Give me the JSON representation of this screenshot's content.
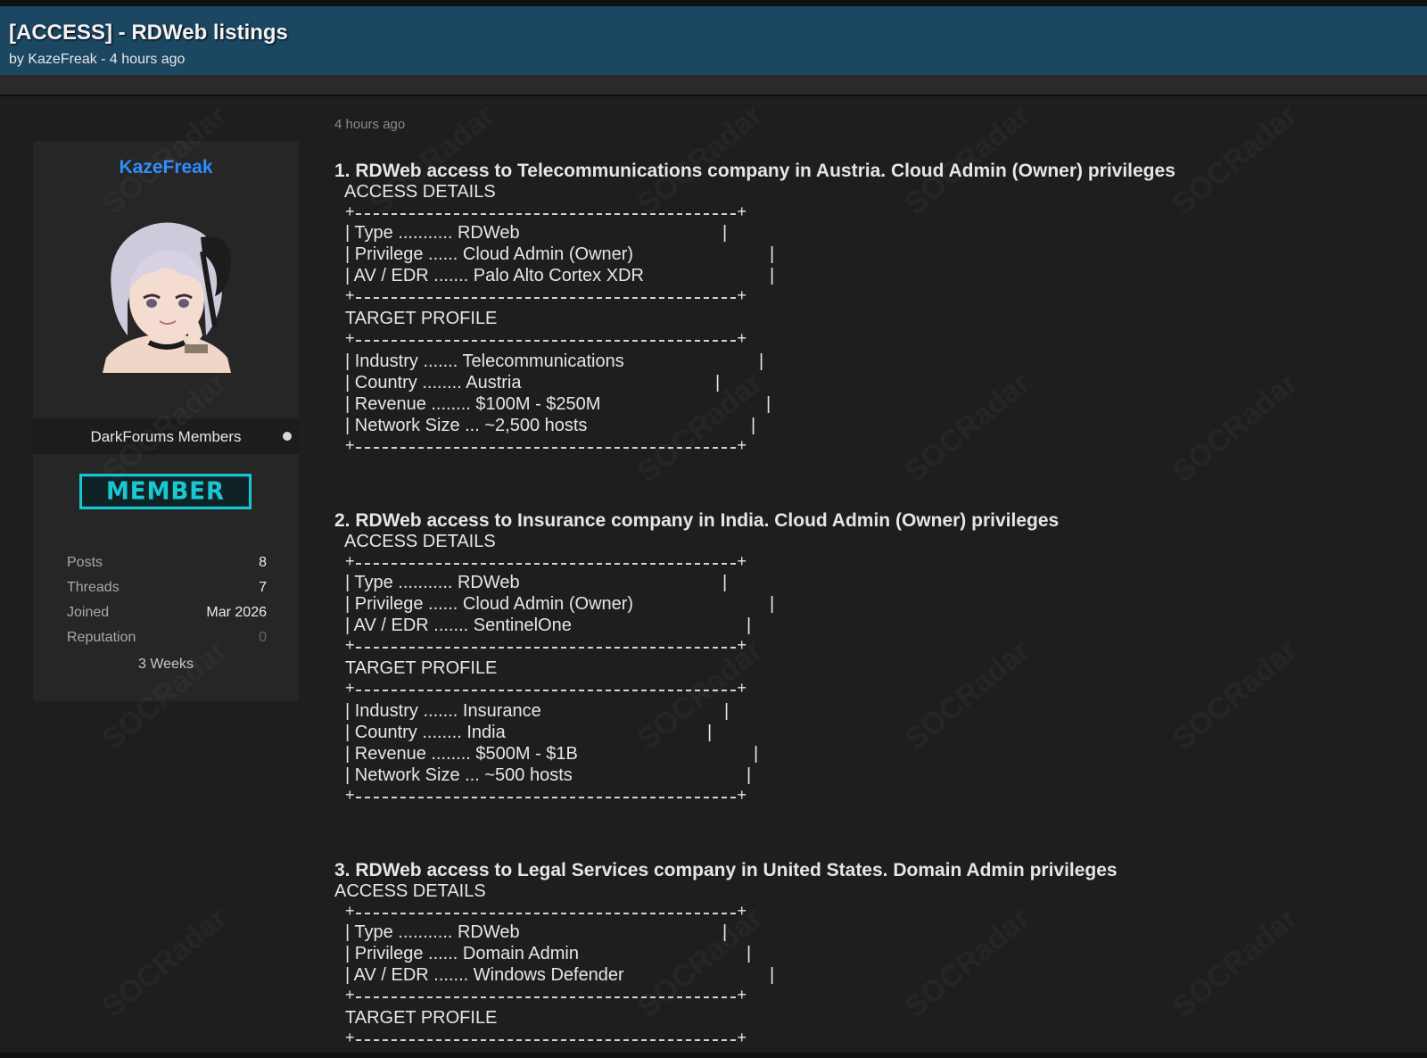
{
  "header": {
    "title": "[ACCESS] - RDWeb listings",
    "byline": "by KazeFreak - 4 hours ago"
  },
  "sidebar": {
    "username": "KazeFreak",
    "usergroup": "DarkForums Members",
    "badge": "MEMBER",
    "stats": [
      {
        "label": "Posts",
        "value": "8"
      },
      {
        "label": "Threads",
        "value": "7"
      },
      {
        "label": "Joined",
        "value": "Mar 2026"
      },
      {
        "label": "Reputation",
        "value": "0"
      }
    ],
    "membership": "3 Weeks"
  },
  "post": {
    "time": "4 hours ago",
    "access_label": "ACCESS DETAILS",
    "target_label": "TARGET PROFILE",
    "listings": [
      {
        "heading": "1. RDWeb access to Telecommunications company in Austria. Cloud Admin (Owner) privileges",
        "access": [
          "| Type ........... RDWeb",
          "| Privilege ...... Cloud Admin (Owner)",
          "| AV / EDR ....... Palo Alto Cortex XDR"
        ],
        "target": [
          "| Industry ....... Telecommunications",
          "| Country ........ Austria",
          "| Revenue ........ $100M - $250M",
          "| Network Size ... ~2,500 hosts"
        ]
      },
      {
        "heading": "2. RDWeb access to Insurance company in India. Cloud Admin (Owner) privileges",
        "access": [
          "| Type ........... RDWeb",
          "| Privilege ...... Cloud Admin (Owner)",
          "| AV / EDR ....... SentinelOne"
        ],
        "target": [
          "| Industry ....... Insurance",
          "| Country ........ India",
          "| Revenue ........ $500M - $1B",
          "| Network Size ... ~500 hosts"
        ]
      },
      {
        "heading": "3. RDWeb access to Legal Services company in United States. Domain Admin privileges",
        "access": [
          "| Type ........... RDWeb",
          "| Privilege ...... Domain Admin",
          "| AV / EDR ....... Windows Defender"
        ],
        "target": []
      }
    ]
  },
  "watermark": "SOCRadar"
}
